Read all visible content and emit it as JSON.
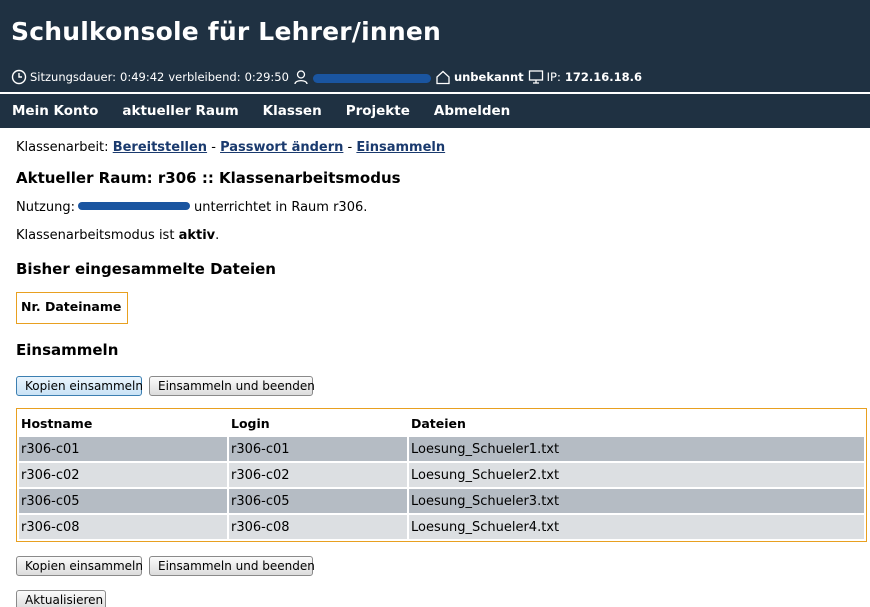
{
  "header": {
    "title": "Schulkonsole für Lehrer/innen",
    "session_label": "Sitzungsdauer:",
    "session_duration": "0:49:42",
    "remaining_label": "verbleibend:",
    "remaining": "0:29:50",
    "location": "unbekannt",
    "ip_label": "IP:",
    "ip": "172.16.18.6"
  },
  "nav": {
    "items": [
      "Mein Konto",
      "aktueller Raum",
      "Klassen",
      "Projekte",
      "Abmelden"
    ]
  },
  "subnav": {
    "prefix": "Klassenarbeit:",
    "links": [
      "Bereitstellen",
      "Passwort ändern",
      "Einsammeln"
    ],
    "separator": "-"
  },
  "room": {
    "heading": "Aktueller Raum: r306 :: Klassenarbeitsmodus",
    "usage_prefix": "Nutzung:",
    "usage_suffix": "unterrichtet in Raum r306.",
    "mode_text": "Klassenarbeitsmodus ist",
    "mode_value": "aktiv",
    "mode_end": "."
  },
  "collected": {
    "heading": "Bisher eingesammelte Dateien",
    "columns": "Nr. Dateiname"
  },
  "collect": {
    "heading": "Einsammeln",
    "copy_button": "Kopien einsammeln",
    "finish_button": "Einsammeln und beenden",
    "refresh_button": "Aktualisieren",
    "table": {
      "headers": [
        "Hostname",
        "Login",
        "Dateien"
      ],
      "rows": [
        [
          "r306-c01",
          "r306-c01",
          "Loesung_Schueler1.txt"
        ],
        [
          "r306-c02",
          "r306-c02",
          "Loesung_Schueler2.txt"
        ],
        [
          "r306-c05",
          "r306-c05",
          "Loesung_Schueler3.txt"
        ],
        [
          "r306-c08",
          "r306-c08",
          "Loesung_Schueler4.txt"
        ]
      ]
    }
  },
  "colors": {
    "header_bg": "#1f3142",
    "link": "#1a3a6e",
    "table_border": "#e8a020",
    "row_dark": "#b5bcc4",
    "row_light": "#dcdfe2",
    "redaction": "#1a55a0"
  },
  "icons": [
    "clock-icon",
    "user-icon",
    "home-icon",
    "monitor-icon"
  ]
}
